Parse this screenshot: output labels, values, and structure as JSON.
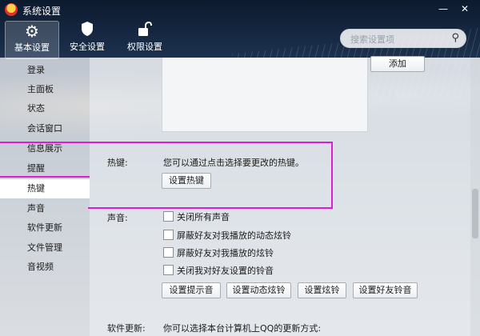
{
  "window": {
    "title": "系统设置"
  },
  "toolbar": [
    {
      "label": "基本设置",
      "icon": "gear-icon",
      "active": true
    },
    {
      "label": "安全设置",
      "icon": "shield-icon",
      "active": false
    },
    {
      "label": "权限设置",
      "icon": "lock-icon",
      "active": false
    }
  ],
  "search": {
    "placeholder": "搜索设置项"
  },
  "sidebar": {
    "items": [
      "登录",
      "主面板",
      "状态",
      "会话窗口",
      "信息展示",
      "提醒",
      "热键",
      "声音",
      "软件更新",
      "文件管理",
      "音视频"
    ],
    "active_index": 6
  },
  "content": {
    "top_button": "添加",
    "hotkey": {
      "label": "热键:",
      "desc": "您可以通过点击选择要更改的热键。",
      "button": "设置热键"
    },
    "sound": {
      "label": "声音:",
      "options": [
        "关闭所有声音",
        "屏蔽好友对我播放的动态炫铃",
        "屏蔽好友对我播放的炫铃",
        "关闭我对好友设置的铃音"
      ],
      "buttons": [
        "设置提示音",
        "设置动态炫铃",
        "设置炫铃",
        "设置好友铃音"
      ]
    },
    "update": {
      "label": "软件更新:",
      "desc": "你可以选择本台计算机上QQ的更新方式:"
    }
  },
  "colors": {
    "highlight": "#e11bd0"
  }
}
